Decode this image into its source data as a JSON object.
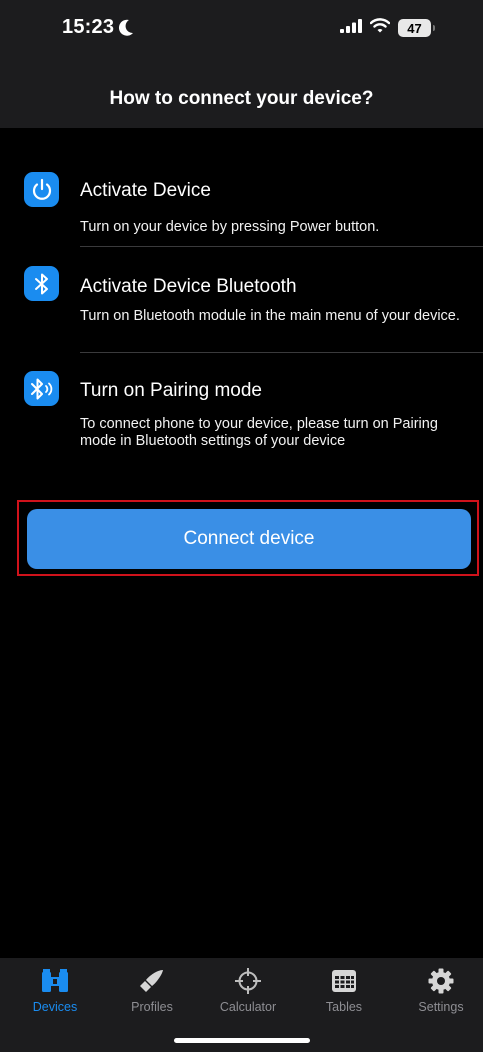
{
  "status_bar": {
    "time": "15:23",
    "battery": "47"
  },
  "header": {
    "title": "How to connect your device?"
  },
  "steps": [
    {
      "icon": "power-icon",
      "title": "Activate Device",
      "description": "Turn on your device by pressing Power button."
    },
    {
      "icon": "bluetooth-icon",
      "title": "Activate Device Bluetooth",
      "description": "Turn on Bluetooth module in the main menu of your device."
    },
    {
      "icon": "bluetooth-pairing-icon",
      "title": "Turn on Pairing mode",
      "description": "To connect phone to your device, please turn on Pairing mode in Bluetooth settings of your device"
    }
  ],
  "connect_button": {
    "label": "Connect device"
  },
  "tab_bar": {
    "tabs": [
      {
        "label": "Devices",
        "icon": "binoculars-icon",
        "active": true
      },
      {
        "label": "Profiles",
        "icon": "bullet-icon",
        "active": false
      },
      {
        "label": "Calculator",
        "icon": "crosshair-icon",
        "active": false
      },
      {
        "label": "Tables",
        "icon": "table-icon",
        "active": false
      },
      {
        "label": "Settings",
        "icon": "gear-icon",
        "active": false
      }
    ]
  },
  "colors": {
    "accent": "#1a8cf0",
    "button": "#3a8fe6",
    "highlight_border": "#d0121b",
    "background": "#000000",
    "bar_background": "#1c1c1e",
    "inactive_tab": "#8e8e93"
  }
}
